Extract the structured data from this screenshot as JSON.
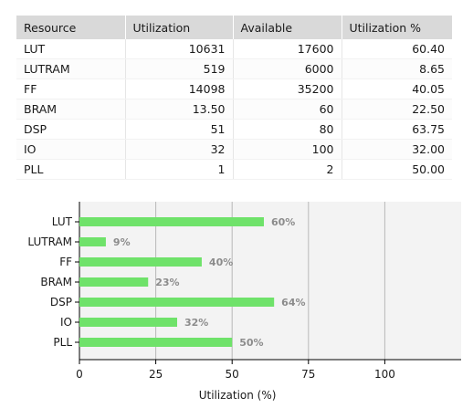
{
  "table": {
    "headers": [
      "Resource",
      "Utilization",
      "Available",
      "Utilization %"
    ],
    "rows": [
      {
        "resource": "LUT",
        "utilization": "10631",
        "available": "17600",
        "percent": "60.40"
      },
      {
        "resource": "LUTRAM",
        "utilization": "519",
        "available": "6000",
        "percent": "8.65"
      },
      {
        "resource": "FF",
        "utilization": "14098",
        "available": "35200",
        "percent": "40.05"
      },
      {
        "resource": "BRAM",
        "utilization": "13.50",
        "available": "60",
        "percent": "22.50"
      },
      {
        "resource": "DSP",
        "utilization": "51",
        "available": "80",
        "percent": "63.75"
      },
      {
        "resource": "IO",
        "utilization": "32",
        "available": "100",
        "percent": "32.00"
      },
      {
        "resource": "PLL",
        "utilization": "1",
        "available": "2",
        "percent": "50.00"
      }
    ]
  },
  "chart_data": {
    "type": "bar",
    "orientation": "horizontal",
    "categories": [
      "LUT",
      "LUTRAM",
      "FF",
      "BRAM",
      "DSP",
      "IO",
      "PLL"
    ],
    "values": [
      60.4,
      8.65,
      40.05,
      22.5,
      63.75,
      32.0,
      50.0
    ],
    "data_labels": [
      "60%",
      "9%",
      "40%",
      "23%",
      "64%",
      "32%",
      "50%"
    ],
    "xlabel": "Utilization (%)",
    "ylabel": "",
    "xlim": [
      0,
      125
    ],
    "xticks": [
      "0",
      "25",
      "50",
      "75",
      "100"
    ],
    "grid": true,
    "colors": {
      "bar": "#6fe26a",
      "plot_background": "#f3f3f3",
      "gridline": "#b8b8b8",
      "value_label": "#8c8c8c"
    }
  }
}
